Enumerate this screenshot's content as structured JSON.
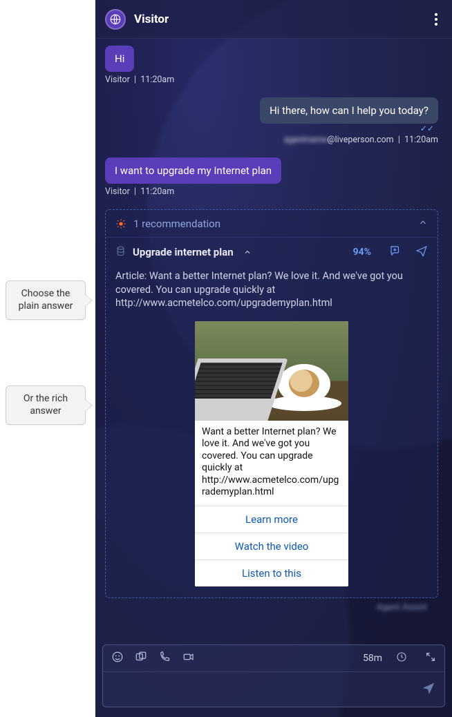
{
  "header": {
    "title": "Visitor"
  },
  "conversation": {
    "msg1": {
      "text": "Hi",
      "sender": "Visitor",
      "time": "11:20am"
    },
    "msg2": {
      "text": "Hi there, how can I help you today?",
      "senderSuffix": "@liveperson.com",
      "senderBlur": "agentname",
      "time": "11:20am"
    },
    "msg3": {
      "text": "I want to upgrade my Internet plan",
      "sender": "Visitor",
      "time": "11:20am"
    }
  },
  "recommendation": {
    "heading": "1 recommendation",
    "item": {
      "title": "Upgrade internet plan",
      "confidence": "94%",
      "article": "Article: Want a better Internet plan? We love it. And we've got you covered. You can upgrade quickly at http://www.acmetelco.com/upgrademyplan.html",
      "card": {
        "body": "Want a better Internet plan? We love it. And we've got you covered. You can upgrade quickly at http://www.acmetelco.com/upgrademyplan.html",
        "buttons": {
          "b1": "Learn more",
          "b2": "Watch the video",
          "b3": "Listen to this"
        }
      }
    }
  },
  "agentAssist": "Agent Assist",
  "composer": {
    "elapsed": "58m",
    "placeholder": ""
  },
  "callouts": {
    "c1": "Choose the plain answer",
    "c2": "Or the rich answer"
  }
}
